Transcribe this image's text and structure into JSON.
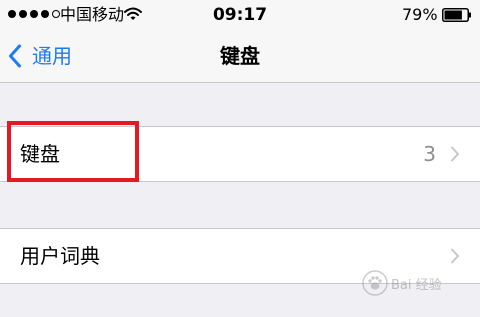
{
  "status_bar": {
    "signal_strength": {
      "filled": 4,
      "total": 5
    },
    "carrier": "中国移动",
    "wifi_icon": "wifi-icon",
    "time": "09:17",
    "battery_percent": "79%",
    "battery_level": 0.79
  },
  "nav": {
    "back_label": "通用",
    "title": "键盘"
  },
  "groups": [
    {
      "rows": [
        {
          "label": "键盘",
          "detail": "3",
          "icon": "chevron-right-icon"
        }
      ]
    },
    {
      "rows": [
        {
          "label": "用户词典",
          "icon": "chevron-right-icon"
        }
      ]
    }
  ],
  "annotation": {
    "color": "#e21a24"
  },
  "watermark": {
    "text": "Bai 经验"
  },
  "colors": {
    "accent": "#1d7bf6",
    "background": "#efeff4",
    "detail_gray": "#8e8e93",
    "chevron_gray": "#c7c7cc"
  }
}
